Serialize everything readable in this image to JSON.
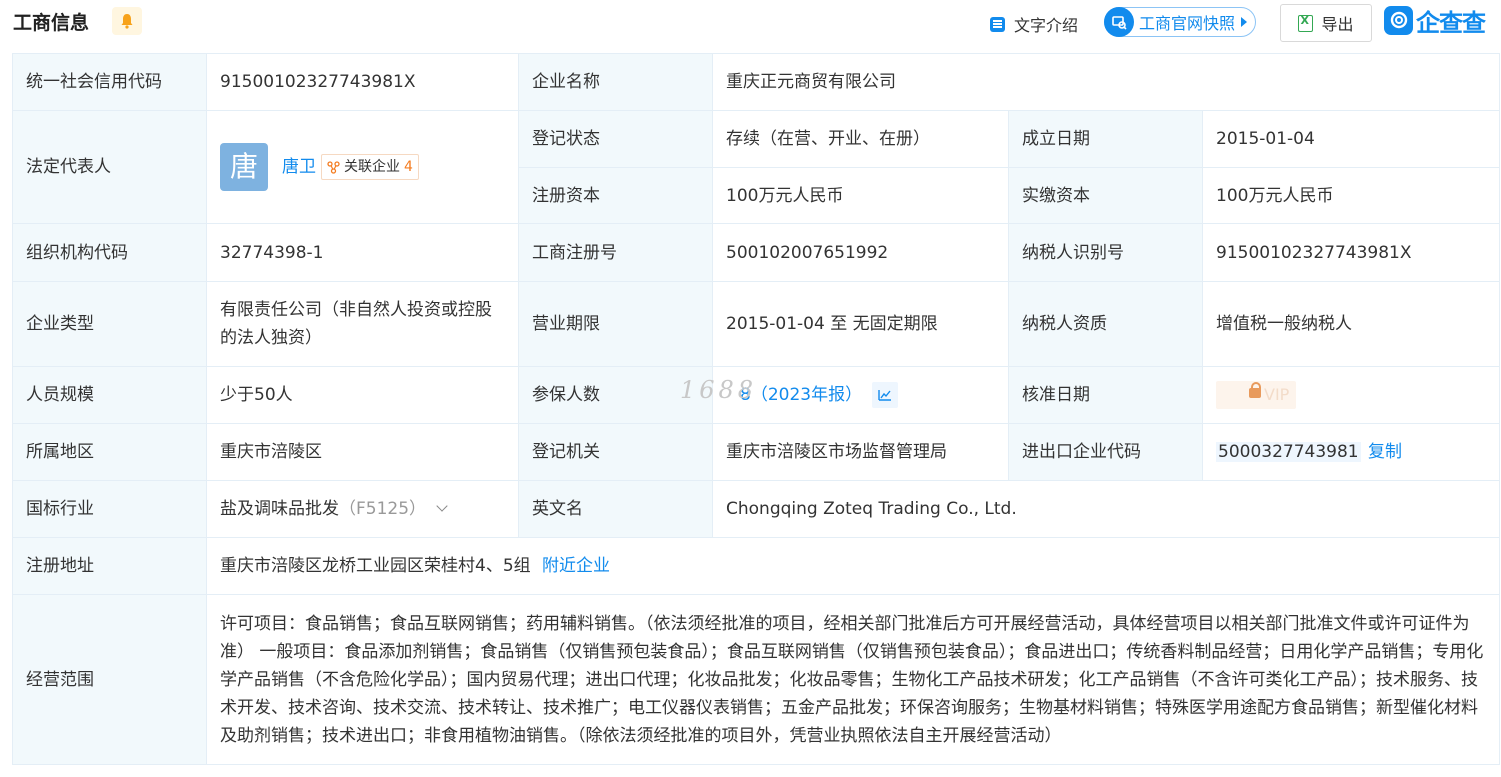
{
  "header": {
    "title": "工商信息",
    "actions": {
      "text_intro": "文字介绍",
      "official_snapshot": "工商官网快照",
      "export": "导出"
    },
    "logo_text": "企查查"
  },
  "colors": {
    "accent": "#128bed",
    "label_bg": "#f2f9fc",
    "border": "#e4eef6",
    "tag_orange": "#f47c20"
  },
  "rows": {
    "credit_code": {
      "label": "统一社会信用代码",
      "value": "91500102327743981X"
    },
    "company_name": {
      "label": "企业名称",
      "value": "重庆正元商贸有限公司"
    },
    "legal_rep": {
      "label": "法定代表人",
      "avatar_char": "唐",
      "name": "唐卫",
      "related_label": "关联企业",
      "related_count": "4"
    },
    "reg_status": {
      "label": "登记状态",
      "value": "存续（在营、开业、在册）"
    },
    "found_date": {
      "label": "成立日期",
      "value": "2015-01-04"
    },
    "reg_capital": {
      "label": "注册资本",
      "value": "100万元人民币"
    },
    "paid_capital": {
      "label": "实缴资本",
      "value": "100万元人民币"
    },
    "org_code": {
      "label": "组织机构代码",
      "value": "32774398-1"
    },
    "biz_reg_no": {
      "label": "工商注册号",
      "value": "500102007651992"
    },
    "taxpayer_id": {
      "label": "纳税人识别号",
      "value": "91500102327743981X"
    },
    "company_type": {
      "label": "企业类型",
      "value": "有限责任公司（非自然人投资或控股的法人独资）"
    },
    "biz_term": {
      "label": "营业期限",
      "value": "2015-01-04 至 无固定期限"
    },
    "taxpayer_qual": {
      "label": "纳税人资质",
      "value": "增值税一般纳税人"
    },
    "staff_size": {
      "label": "人员规模",
      "value": "少于50人"
    },
    "insured": {
      "label": "参保人数",
      "value": "8",
      "year_note": "（2023年报）",
      "watermark": "1688"
    },
    "approval_date": {
      "label": "核准日期",
      "vip": "VIP"
    },
    "region": {
      "label": "所属地区",
      "value": "重庆市涪陵区"
    },
    "reg_authority": {
      "label": "登记机关",
      "value": "重庆市涪陵区市场监督管理局"
    },
    "ie_code": {
      "label": "进出口企业代码",
      "value": "5000327743981",
      "copy": "复制"
    },
    "industry": {
      "label": "国标行业",
      "value": "盐及调味品批发",
      "code": "（F5125）"
    },
    "english_name": {
      "label": "英文名",
      "value": "Chongqing Zoteq Trading Co., Ltd."
    },
    "reg_address": {
      "label": "注册地址",
      "value": "重庆市涪陵区龙桥工业园区荣桂村4、5组",
      "nearby": "附近企业"
    },
    "biz_scope": {
      "label": "经营范围",
      "value": "许可项目：食品销售；食品互联网销售；药用辅料销售。（依法须经批准的项目，经相关部门批准后方可开展经营活动，具体经营项目以相关部门批准文件或许可证件为准） 一般项目：食品添加剂销售；食品销售（仅销售预包装食品）；食品互联网销售（仅销售预包装食品）；食品进出口；传统香料制品经营；日用化学产品销售；专用化学产品销售（不含危险化学品）；国内贸易代理；进出口代理；化妆品批发；化妆品零售；生物化工产品技术研发；化工产品销售（不含许可类化工产品）；技术服务、技术开发、技术咨询、技术交流、技术转让、技术推广；电工仪器仪表销售；五金产品批发；环保咨询服务；生物基材料销售；特殊医学用途配方食品销售；新型催化材料及助剂销售；技术进出口；非食用植物油销售。（除依法须经批准的项目外，凭营业执照依法自主开展经营活动）"
    }
  }
}
